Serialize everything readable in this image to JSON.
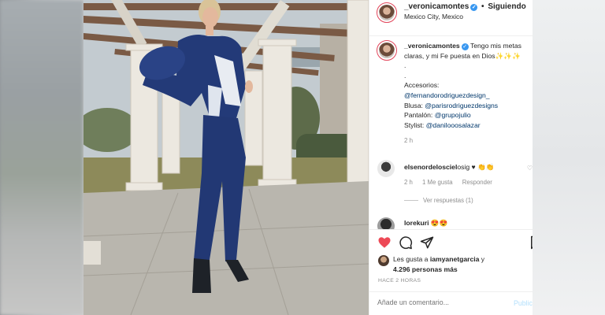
{
  "post": {
    "username": "_veronicamontes",
    "follow_status": "Siguiendo",
    "location": "Mexico City, Mexico",
    "caption_text": "Tengo mis metas claras, y mi Fe puesta en Dios",
    "caption_emoji": "✨✨✨",
    "caption_dots": ".",
    "accessories_label": "Accesorios:",
    "accessories_mention": "@fernandorodriguezdesign_",
    "blusa_label": "Blusa:",
    "blusa_mention": "@parisrodriguezdesigns",
    "pantalon_label": "Pantalón:",
    "pantalon_mention": "@grupojulio",
    "stylist_label": "Stylist:",
    "stylist_mention": "@danilooosalazar",
    "caption_time": "2 h"
  },
  "comments": [
    {
      "username": "elsenordelosciel",
      "text": "osig ♥ 👏👏",
      "time": "2 h",
      "likes": "1 Me gusta",
      "reply": "Responder",
      "view_replies": "Ver respuestas (1)"
    },
    {
      "username": "lorekuri",
      "text": "😍😍"
    }
  ],
  "likes": {
    "text_prefix": "Les gusta a",
    "liker": "iamyanetgarcia",
    "text_y": "y",
    "count": "4.296 personas más"
  },
  "time_ago": "HACE 2 HORAS",
  "add_comment_placeholder": "Añade un comentario...",
  "publish_label": "Publicar",
  "colors": {
    "accent_blue": "#0095f6",
    "heart_red": "#ed4956",
    "mention": "#00376b"
  }
}
